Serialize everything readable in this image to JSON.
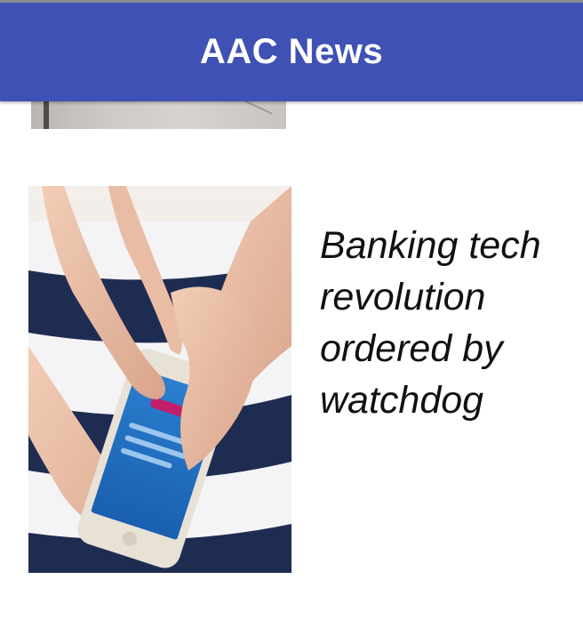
{
  "app_bar": {
    "title": "AAC News",
    "color": "#3f51b5"
  },
  "news_items": [
    {
      "headline": "Banking tech revolution ordered by watchdog",
      "thumbnail_icon": "phone-banking-photo"
    }
  ]
}
